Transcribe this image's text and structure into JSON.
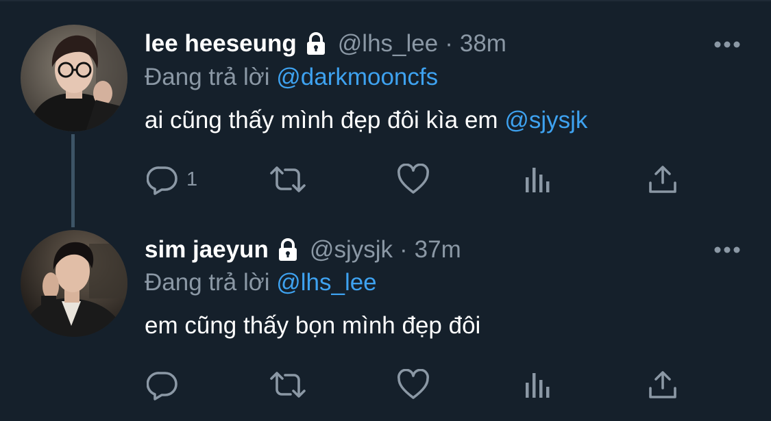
{
  "colors": {
    "background": "#15202b",
    "primary_text": "#ffffff",
    "secondary_text": "#8b98a5",
    "accent": "#3ea2f0",
    "thread_line": "#3d5466"
  },
  "tweets": [
    {
      "display_name": "lee heeseung",
      "protected_icon": "lock-icon",
      "handle": "@lhs_lee",
      "separator": "·",
      "time": "38m",
      "replying_prefix": "Đang trả lời",
      "replying_to": "@darkmooncfs",
      "text": "ai cũng thấy mình đẹp đôi kìa em",
      "text_mention": "@sjysjk",
      "reply_count": "1",
      "icons": [
        "reply-icon",
        "retweet-icon",
        "like-icon",
        "views-icon",
        "share-icon",
        "more-icon"
      ]
    },
    {
      "display_name": "sim jaeyun",
      "protected_icon": "lock-icon",
      "handle": "@sjysjk",
      "separator": "·",
      "time": "37m",
      "replying_prefix": "Đang trả lời",
      "replying_to": "@lhs_lee",
      "text": "em cũng thấy bọn mình đẹp đôi",
      "icons": [
        "reply-icon",
        "retweet-icon",
        "like-icon",
        "views-icon",
        "share-icon",
        "more-icon"
      ]
    }
  ]
}
